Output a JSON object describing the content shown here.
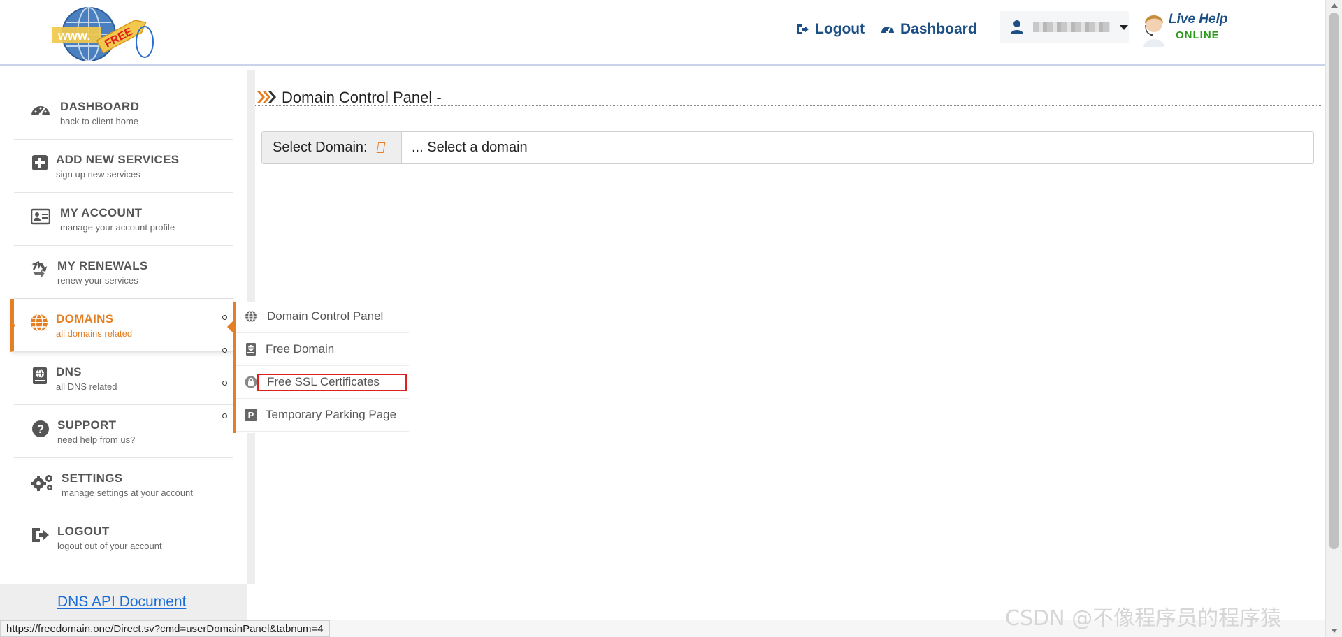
{
  "header": {
    "logo": {
      "text": "www.",
      "tag": "FREE"
    },
    "logout_label": "Logout",
    "dashboard_label": "Dashboard",
    "live_help": {
      "title": "Live Help",
      "status": "ONLINE"
    }
  },
  "sidebar": {
    "items": [
      {
        "title": "DASHBOARD",
        "subtitle": "back to client home",
        "icon": "dashboard-gauge-icon"
      },
      {
        "title": "ADD NEW SERVICES",
        "subtitle": "sign up new services",
        "icon": "plus-square-icon"
      },
      {
        "title": "MY ACCOUNT",
        "subtitle": "manage your account profile",
        "icon": "id-card-icon"
      },
      {
        "title": "MY RENEWALS",
        "subtitle": "renew your services",
        "icon": "recycle-icon"
      },
      {
        "title": "DOMAINS",
        "subtitle": "all domains related",
        "icon": "globe-icon",
        "active": true
      },
      {
        "title": "DNS",
        "subtitle": "all DNS related",
        "icon": "dns-book-icon"
      },
      {
        "title": "SUPPORT",
        "subtitle": "need help from us?",
        "icon": "question-circle-icon"
      },
      {
        "title": "SETTINGS",
        "subtitle": "manage settings at your account",
        "icon": "gears-icon"
      },
      {
        "title": "LOGOUT",
        "subtitle": "logout out of your account",
        "icon": "sign-out-icon"
      }
    ],
    "api_link": "DNS API Document"
  },
  "flyout": {
    "items": [
      {
        "label": "Domain Control Panel",
        "icon": "globe-icon"
      },
      {
        "label": "Free Domain",
        "icon": "dns-book-icon"
      },
      {
        "label": "Free SSL Certificates",
        "icon": "lock-icon",
        "highlighted": true
      },
      {
        "label": "Temporary Parking Page",
        "icon": "parking-icon"
      }
    ]
  },
  "main": {
    "panel_title": "Domain Control Panel -",
    "select_label": "Select Domain:",
    "select_value": "... Select a domain"
  },
  "status_bar": {
    "url": "https://freedomain.one/Direct.sv?cmd=userDomainPanel&tabnum=4"
  },
  "watermark": "CSDN @不像程序员的程序猿",
  "colors": {
    "accent": "#e57f23",
    "brand": "#1c4f86",
    "link": "#1a6cd6",
    "highlight": "#e0201b",
    "online": "#2b9a1a"
  }
}
